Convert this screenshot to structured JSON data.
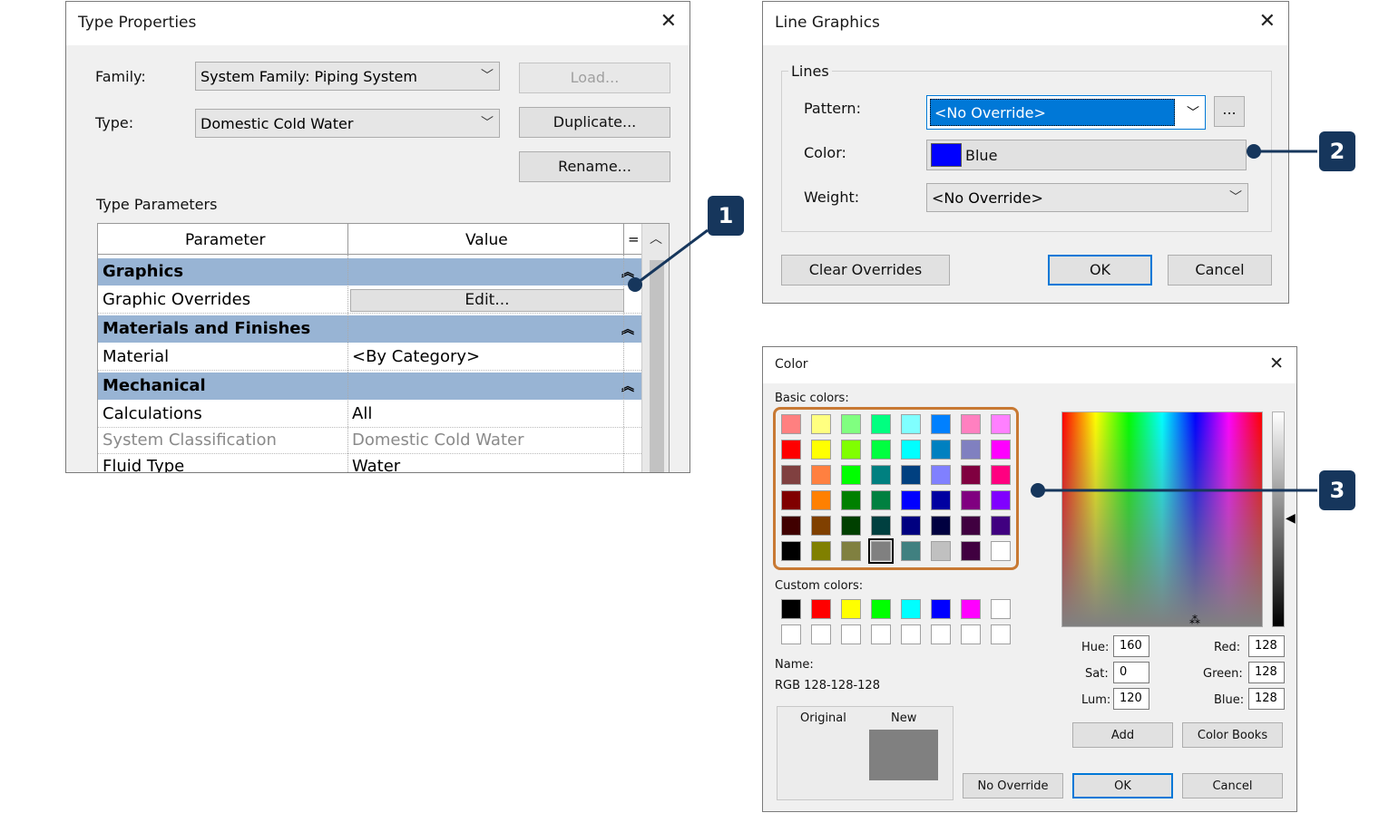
{
  "type_properties": {
    "title": "Type Properties",
    "family_label": "Family:",
    "family_value": "System Family: Piping System",
    "type_label": "Type:",
    "type_value": "Domestic Cold Water",
    "load_label": "Load...",
    "duplicate_label": "Duplicate...",
    "rename_label": "Rename...",
    "section_label": "Type Parameters",
    "col_parameter": "Parameter",
    "col_value": "Value",
    "col_eq": "=",
    "cat_graphics": "Graphics",
    "graphic_overrides": "Graphic Overrides",
    "edit_label": "Edit...",
    "cat_materials": "Materials and Finishes",
    "material": "Material",
    "material_value": "<By Category>",
    "cat_mechanical": "Mechanical",
    "calculations": "Calculations",
    "calculations_value": "All",
    "system_classification": "System Classification",
    "system_classification_value": "Domestic Cold Water",
    "fluid_type": "Fluid Type",
    "fluid_type_value": "Water"
  },
  "line_graphics": {
    "title": "Line Graphics",
    "group_label": "Lines",
    "pattern_label": "Pattern:",
    "pattern_value": "<No Override>",
    "ellipsis_label": "...",
    "color_label": "Color:",
    "color_value": "Blue",
    "weight_label": "Weight:",
    "weight_value": "<No Override>",
    "clear_label": "Clear Overrides",
    "ok_label": "OK",
    "cancel_label": "Cancel"
  },
  "color_dialog": {
    "title": "Color",
    "basic_label": "Basic colors:",
    "custom_label": "Custom colors:",
    "name_label": "Name:",
    "name_value": "RGB 128-128-128",
    "original_label": "Original",
    "new_label": "New",
    "hue_label": "Hue:",
    "hue_value": "160",
    "sat_label": "Sat:",
    "sat_value": "0",
    "lum_label": "Lum:",
    "lum_value": "120",
    "red_label": "Red:",
    "red_value": "128",
    "green_label": "Green:",
    "green_value": "128",
    "blue_label": "Blue:",
    "blue_value": "128",
    "add_label": "Add",
    "color_books_label": "Color Books",
    "no_override_label": "No Override",
    "ok_label": "OK",
    "cancel_label": "Cancel",
    "basic_colors": [
      [
        "#ff8080",
        "#ffff80",
        "#80ff80",
        "#00ff80",
        "#80ffff",
        "#0080ff",
        "#ff80c0",
        "#ff80ff"
      ],
      [
        "#ff0000",
        "#ffff00",
        "#80ff00",
        "#00ff40",
        "#00ffff",
        "#0080c0",
        "#8080c0",
        "#ff00ff"
      ],
      [
        "#804040",
        "#ff8040",
        "#00ff00",
        "#008080",
        "#004080",
        "#8080ff",
        "#800040",
        "#ff0080"
      ],
      [
        "#800000",
        "#ff8000",
        "#008000",
        "#008040",
        "#0000ff",
        "#0000a0",
        "#800080",
        "#8000ff"
      ],
      [
        "#400000",
        "#804000",
        "#004000",
        "#004040",
        "#000080",
        "#000040",
        "#400040",
        "#400080"
      ],
      [
        "#000000",
        "#808000",
        "#808040",
        "#808080",
        "#408080",
        "#c0c0c0",
        "#400040",
        "#ffffff"
      ]
    ],
    "custom_colors": [
      [
        "#000000",
        "#ff0000",
        "#ffff00",
        "#00ff00",
        "#00ffff",
        "#0000ff",
        "#ff00ff",
        "#ffffff"
      ],
      [
        "#ffffff",
        "#ffffff",
        "#ffffff",
        "#ffffff",
        "#ffffff",
        "#ffffff",
        "#ffffff",
        "#ffffff"
      ]
    ],
    "selected_color": "#808080"
  },
  "callouts": {
    "c1": "1",
    "c2": "2",
    "c3": "3"
  },
  "colors": {
    "accent": "#0078d7",
    "callout": "#16365c",
    "highlight_ring": "#c87933",
    "category_row": "#98b4d4"
  }
}
